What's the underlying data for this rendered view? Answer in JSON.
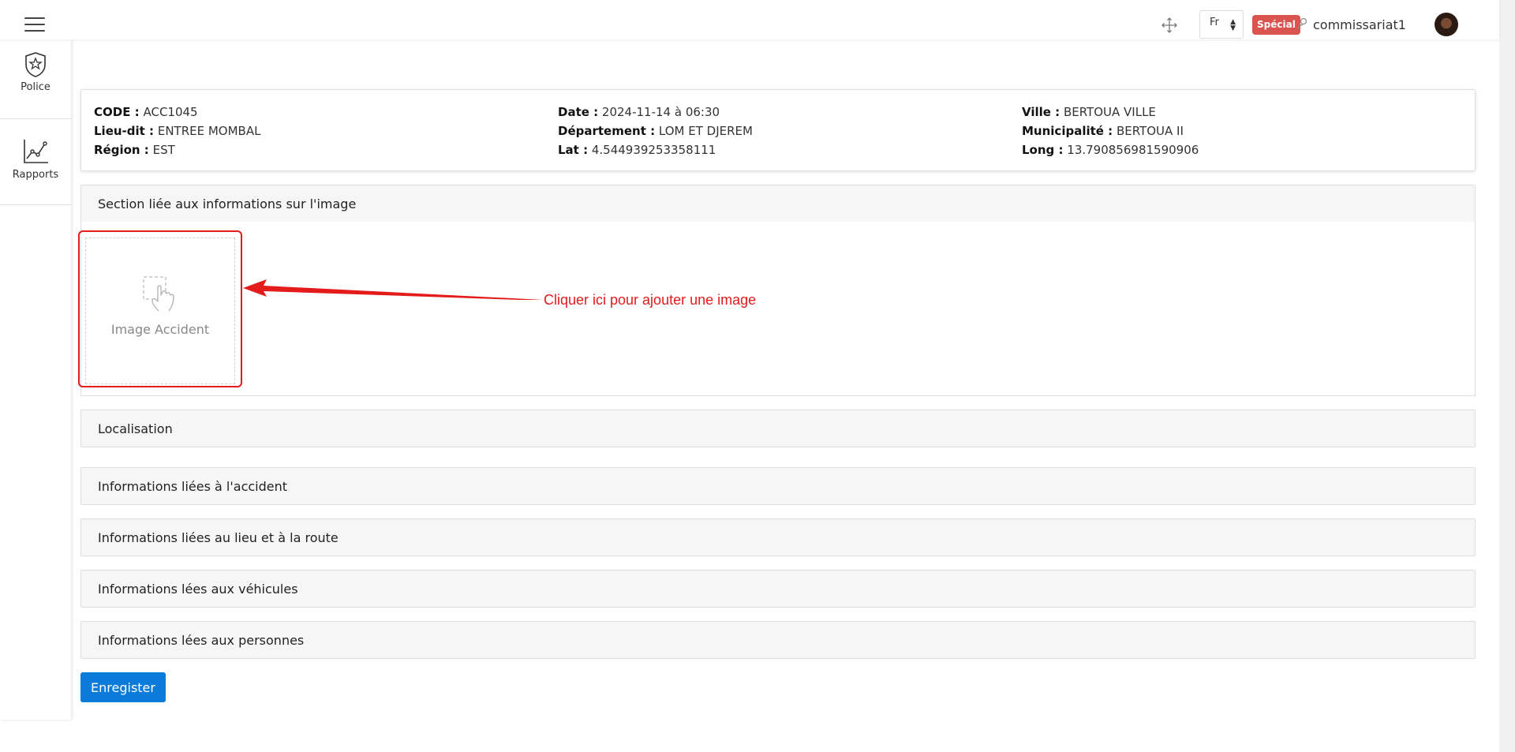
{
  "topbar": {
    "lang": "Fr",
    "badge": "Spécial",
    "username": "commissariat1"
  },
  "sidebar": {
    "items": [
      {
        "label": "Police",
        "icon": "shield-star-icon"
      },
      {
        "label": "Rapports",
        "icon": "chart-line-icon"
      }
    ]
  },
  "info": {
    "col1": [
      {
        "key": "CODE :",
        "value": "ACC1045"
      },
      {
        "key": "Lieu-dit :",
        "value": "ENTREE MOMBAL"
      },
      {
        "key": "Région :",
        "value": "EST"
      }
    ],
    "col2": [
      {
        "key": "Date :",
        "value": "2024-11-14 à 06:30"
      },
      {
        "key": "Département :",
        "value": "LOM ET DJEREM"
      },
      {
        "key": "Lat :",
        "value": "4.544939253358111"
      }
    ],
    "col3": [
      {
        "key": "Ville :",
        "value": "BERTOUA VILLE"
      },
      {
        "key": "Municipalité :",
        "value": "BERTOUA II"
      },
      {
        "key": "Long :",
        "value": "13.790856981590906"
      }
    ]
  },
  "sections": {
    "image": "Section liée aux informations sur l'image",
    "localisation": "Localisation",
    "accident": "Informations liées à l'accident",
    "lieu": "Informations liées au lieu et à la route",
    "vehicules": "Informations lées aux véhicules",
    "personnes": "Informations lées aux personnes"
  },
  "image_upload": {
    "label": "Image Accident",
    "hint": "Cliquer ici pour ajouter une image"
  },
  "actions": {
    "save": "Enregister"
  },
  "colors": {
    "accent": "#0a7bd8",
    "badge": "#d9534f",
    "annotation": "#e31b1b"
  }
}
